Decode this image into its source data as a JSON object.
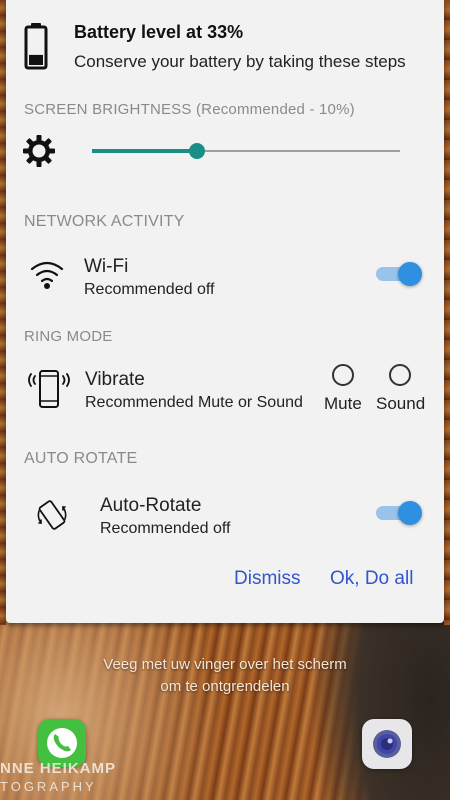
{
  "colors": {
    "accent_teal": "#1a8f86",
    "toggle_blue": "#2f8fe0",
    "link_blue": "#3355cc",
    "phone_green": "#43c040"
  },
  "dialog": {
    "icon": "battery-low-icon",
    "title": "Battery level at 33%",
    "subtitle": "Conserve your battery by taking these steps",
    "battery_level": 0.33
  },
  "brightness": {
    "header": "SCREEN BRIGHTNESS (Recommended - 10%)",
    "icon": "brightness-gear-icon",
    "slider_value": 0.34
  },
  "network": {
    "header": "NETWORK ACTIVITY",
    "icon": "wifi-icon",
    "title": "Wi-Fi",
    "subtitle": "Recommended off",
    "toggle_on": true
  },
  "ring": {
    "header": "RING MODE",
    "icon": "vibrate-phone-icon",
    "title": "Vibrate",
    "subtitle": "Recommended Mute or Sound",
    "options": [
      "Mute",
      "Sound"
    ]
  },
  "rotate": {
    "header": "AUTO ROTATE",
    "icon": "auto-rotate-icon",
    "title": "Auto-Rotate",
    "subtitle": "Recommended off",
    "toggle_on": true
  },
  "actions": {
    "dismiss": "Dismiss",
    "do_all": "Ok, Do all"
  },
  "lockscreen": {
    "unlock_line1": "Veeg met uw vinger over het scherm",
    "unlock_line2": "om te ontgrendelen",
    "phone_icon": "phone-icon",
    "camera_icon": "camera-icon",
    "watermark_line1": "NNE HEIKAMP",
    "watermark_line2": "TOGRAPHY"
  }
}
